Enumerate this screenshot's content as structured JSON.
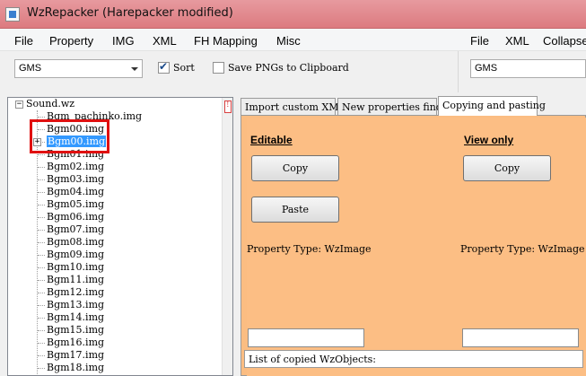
{
  "window": {
    "title": "WzRepacker (Harepacker modified)"
  },
  "menu_left": {
    "file": "File",
    "property": "Property",
    "img": "IMG",
    "xml": "XML",
    "fh_mapping": "FH Mapping",
    "misc": "Misc"
  },
  "menu_right": {
    "file": "File",
    "xml": "XML",
    "collapse": "Collapse"
  },
  "toolbar": {
    "version_select": "GMS",
    "sort_label": "Sort",
    "sort_checked": true,
    "save_pngs_label": "Save PNGs to Clipboard",
    "save_pngs_checked": false,
    "right_version_select": "GMS"
  },
  "tree": {
    "root": "Sound.wz",
    "items": [
      "Bgm_pachinko.img",
      "Bgm00.img",
      "Bgm00.img",
      "Bgm01.img",
      "Bgm02.img",
      "Bgm03.img",
      "Bgm04.img",
      "Bgm05.img",
      "Bgm06.img",
      "Bgm07.img",
      "Bgm08.img",
      "Bgm09.img",
      "Bgm10.img",
      "Bgm11.img",
      "Bgm12.img",
      "Bgm13.img",
      "Bgm14.img",
      "Bgm15.img",
      "Bgm16.img",
      "Bgm17.img",
      "Bgm18.img"
    ],
    "selected_index": 2,
    "scroll_marker": "!"
  },
  "tabs": {
    "import_xml": "Import custom XML",
    "props_finder": "New properties finder",
    "copy_paste": "Copying and pasting"
  },
  "copy_paste": {
    "editable_heading": "Editable",
    "view_only_heading": "View only",
    "copy_button": "Copy",
    "paste_button": "Paste",
    "view_copy_button": "Copy",
    "property_type_left": "Property Type: WzImage",
    "property_type_right": "Property Type: WzImage",
    "list_label": "List of copied WzObjects:"
  },
  "colors": {
    "titlebar": "#e0848a",
    "panel": "#fcbe84",
    "selection": "#3399ff",
    "highlight_box": "#e01010"
  }
}
